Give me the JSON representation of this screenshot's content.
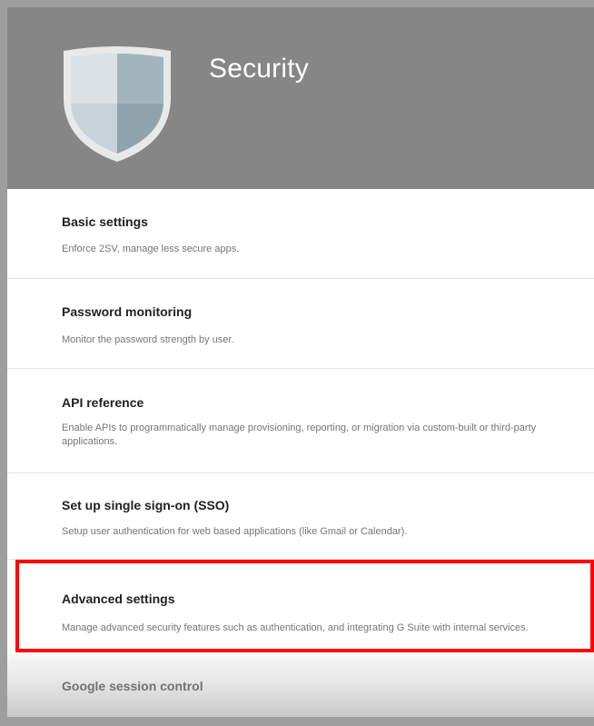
{
  "header": {
    "title": "Security",
    "icon": "shield-icon",
    "background": "#868686"
  },
  "items": [
    {
      "title": "Basic settings",
      "description": "Enforce 2SV, manage less secure apps."
    },
    {
      "title": "Password monitoring",
      "description": "Monitor the password strength by user."
    },
    {
      "title": "API reference",
      "description": "Enable APIs to programmatically manage provisioning, reporting, or migration via custom-built or third-party applications."
    },
    {
      "title": "Set up single sign-on (SSO)",
      "description": "Setup user authentication for web based applications (like Gmail or Calendar)."
    },
    {
      "title": "Advanced settings",
      "description": "Manage advanced security features such as authentication, and integrating G Suite with internal services."
    },
    {
      "title": "Google session control",
      "description": ""
    }
  ],
  "highlight_color": "#ff0000"
}
